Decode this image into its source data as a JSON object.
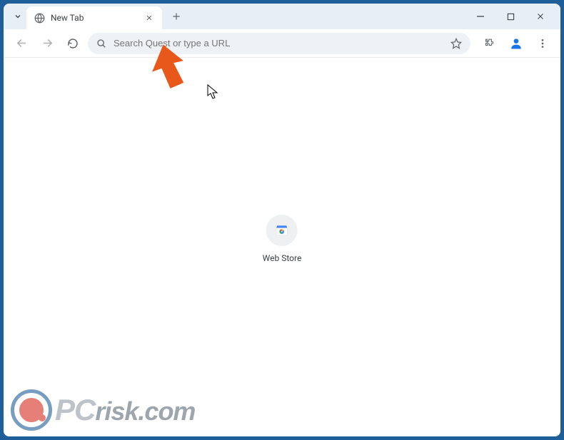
{
  "tab": {
    "title": "New Tab"
  },
  "omnibox": {
    "placeholder": "Search Quest or type a URL"
  },
  "shortcut": {
    "label": "Web Store"
  },
  "watermark": {
    "brand": "PC",
    "domain": "risk.com"
  }
}
